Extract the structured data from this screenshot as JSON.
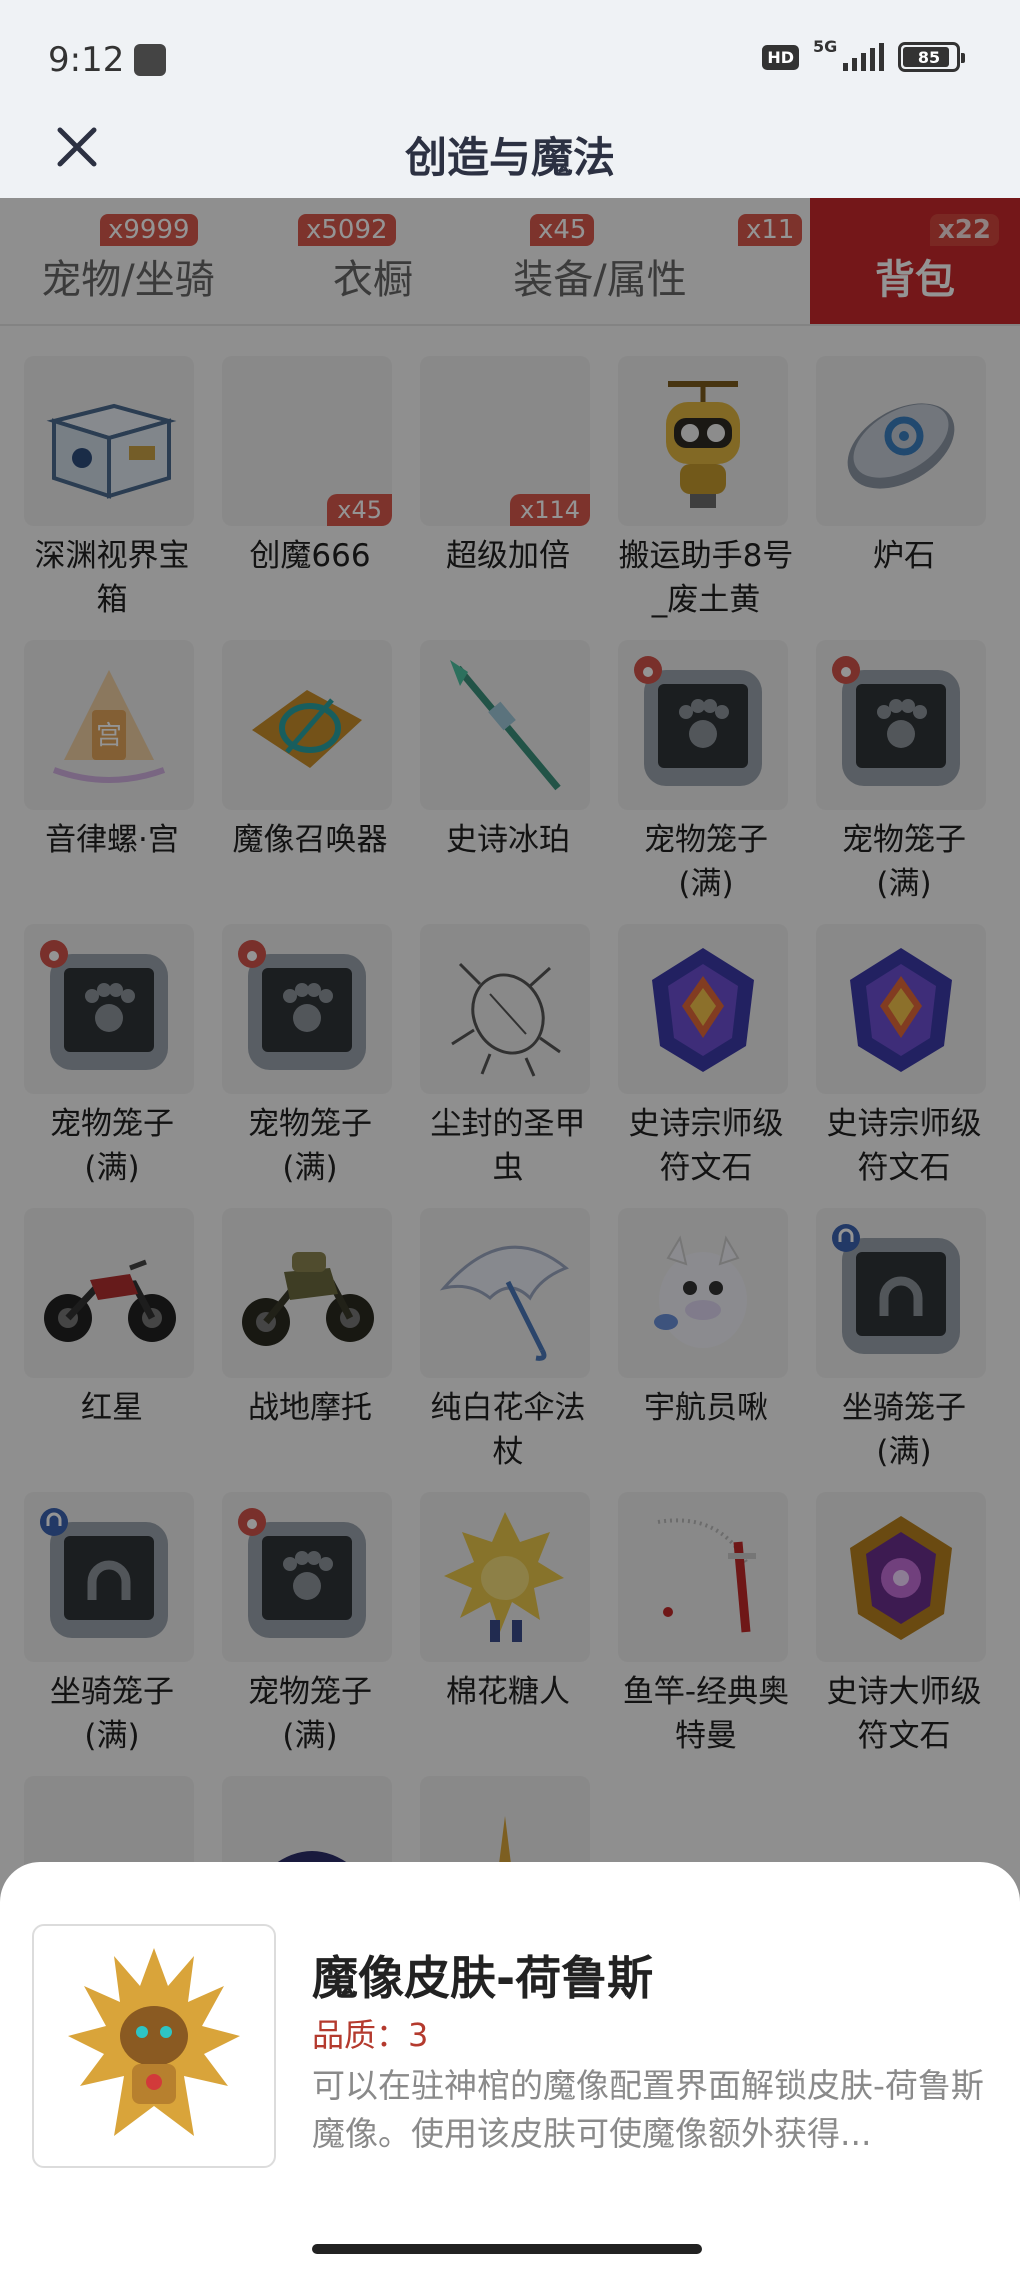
{
  "status": {
    "time": "9:12",
    "hd": "HD",
    "network": "5G",
    "battery": "85"
  },
  "header": {
    "title": "创造与魔法",
    "close_icon": "close-icon"
  },
  "tabs": [
    {
      "label": "宠物/坐骑",
      "badge": "x9999",
      "active": false
    },
    {
      "label": "衣橱",
      "badge": "x5092",
      "active": false
    },
    {
      "label": "装备/属性",
      "badge": "x45",
      "active": false
    },
    {
      "label": "",
      "badge": "x11",
      "active": false
    },
    {
      "label": "背包",
      "badge": "x22",
      "active": true
    }
  ],
  "items": [
    {
      "name": "深渊视界宝箱",
      "icon": "treasure-chest-icon"
    },
    {
      "name": "创魔666",
      "icon": "blank-item-icon",
      "count": "x45"
    },
    {
      "name": "超级加倍",
      "icon": "blank-item-icon",
      "count": "x114"
    },
    {
      "name": "搬运助手8号_废土黄",
      "icon": "robot-icon"
    },
    {
      "name": "炉石",
      "icon": "hearthstone-icon"
    },
    {
      "name": "音律螺·宫",
      "icon": "music-shell-icon"
    },
    {
      "name": "魔像召唤器",
      "icon": "golem-summoner-icon"
    },
    {
      "name": "史诗冰珀",
      "icon": "ice-spear-icon"
    },
    {
      "name": "宠物笼子(满)",
      "icon": "pet-cage-icon"
    },
    {
      "name": "宠物笼子(满)",
      "icon": "pet-cage-icon"
    },
    {
      "name": "宠物笼子(满)",
      "icon": "pet-cage-icon"
    },
    {
      "name": "宠物笼子(满)",
      "icon": "pet-cage-icon"
    },
    {
      "name": "尘封的圣甲虫",
      "icon": "scarab-icon"
    },
    {
      "name": "史诗宗师级符文石",
      "icon": "rune-stone-icon"
    },
    {
      "name": "史诗宗师级符文石",
      "icon": "rune-stone-icon"
    },
    {
      "name": "红星",
      "icon": "motorcycle-icon"
    },
    {
      "name": "战地摩托",
      "icon": "motorcycle-icon"
    },
    {
      "name": "纯白花伞法杖",
      "icon": "umbrella-icon"
    },
    {
      "name": "宇航员啾",
      "icon": "astronaut-pet-icon"
    },
    {
      "name": "坐骑笼子(满)",
      "icon": "mount-cage-icon"
    },
    {
      "name": "坐骑笼子(满)",
      "icon": "mount-cage-icon"
    },
    {
      "name": "宠物笼子(满)",
      "icon": "pet-cage-icon"
    },
    {
      "name": "棉花糖人",
      "icon": "marshmallow-icon"
    },
    {
      "name": "鱼竿-经典奥特曼",
      "icon": "fishing-rod-icon"
    },
    {
      "name": "史诗大师级符文石",
      "icon": "rune-stone-gold-icon"
    },
    {
      "name": "",
      "icon": "partial-item-icon"
    },
    {
      "name": "",
      "icon": "partial-item-icon"
    },
    {
      "name": "",
      "icon": "partial-item-icon"
    }
  ],
  "detail": {
    "title": "魔像皮肤-荷鲁斯",
    "quality": "品质：3",
    "description": "可以在驻神棺的魔像配置界面解锁皮肤-荷鲁斯魔像。使用该皮肤可使魔像额外获得...",
    "icon": "golem-skin-horus-icon"
  }
}
